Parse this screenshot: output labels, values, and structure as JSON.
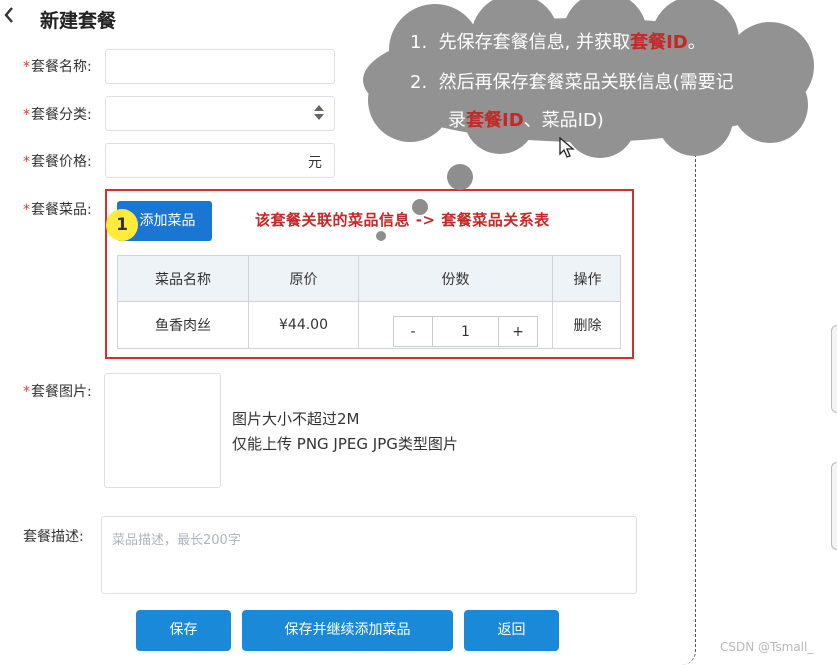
{
  "page": {
    "title": "新建套餐"
  },
  "form": {
    "name_label": "套餐名称:",
    "category_label": "套餐分类:",
    "price_label": "套餐价格:",
    "price_suffix": "元",
    "dishes_label": "套餐菜品:",
    "image_label": "套餐图片:",
    "desc_label": "套餐描述:",
    "desc_placeholder": "菜品描述，最长200字",
    "required_mark": "*"
  },
  "dishes": {
    "add_button": "添加菜品",
    "badge": "1",
    "note": "该套餐关联的菜品信息 -> 套餐菜品关系表",
    "columns": [
      "菜品名称",
      "原价",
      "份数",
      "操作"
    ],
    "rows": [
      {
        "name": "鱼香肉丝",
        "price": "¥44.00",
        "minus": "-",
        "qty": "1",
        "plus": "+",
        "action": "删除"
      }
    ]
  },
  "upload": {
    "hint_line1": "图片大小不超过2M",
    "hint_line2": "仅能上传 PNG JPEG JPG类型图片"
  },
  "buttons": {
    "save": "保存",
    "save_continue": "保存并继续添加菜品",
    "back": "返回"
  },
  "annotation": {
    "step1_num": "1.",
    "step1_pre": "先保存套餐信息, 并获取",
    "step1_hl": "套餐ID",
    "step1_post": "。",
    "step2_num": "2.",
    "step2_line1": "然后再保存套餐菜品关联信息(需要记",
    "step2_pre": "录",
    "step2_hl": "套餐ID",
    "step2_post": "、菜品ID)"
  },
  "watermark": "CSDN @Tsmall_",
  "icons": {
    "back": "chevron-left-icon",
    "select": "select-arrows-icon",
    "cursor": "mouse-pointer-icon"
  }
}
